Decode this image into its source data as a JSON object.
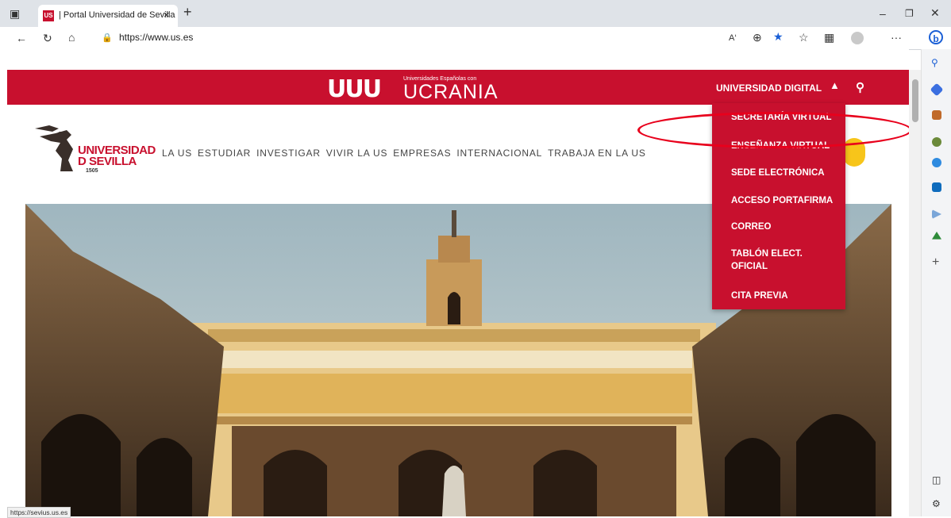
{
  "browser": {
    "tab_title": "| Portal Universidad de Sevilla",
    "tab_favicon_text": "US",
    "tab_close": "×",
    "new_tab": "+",
    "url": "https://www.us.es",
    "status_url": "https://sevius.us.es",
    "more": "···"
  },
  "banner": {
    "campaign_small": "Universidades Españolas con",
    "campaign_title": "UCRANIA",
    "campaign_mark": "UUU",
    "universidad_digital": "UNIVERSIDAD DIGITAL",
    "chevron": "^"
  },
  "logo": {
    "line1": "UNIVERSIDAD",
    "line2": "D SEVILLA",
    "year": "1505"
  },
  "nav": {
    "items": [
      "LA US",
      "ESTUDIAR",
      "INVESTIGAR",
      "VIVIR LA US",
      "EMPRESAS",
      "INTERNACIONAL",
      "TRABAJA EN LA US"
    ]
  },
  "dropdown": {
    "items": [
      "SECRETARÍA VIRTUAL",
      "ENSEÑANZA VIRTUAL",
      "SEDE ELECTRÓNICA",
      "ACCESO PORTAFIRMA",
      "CORREO",
      "TABLÓN ELECT. OFICIAL",
      "CITA PREVIA"
    ]
  },
  "colors": {
    "brand_red": "#c8102e",
    "accent_yellow": "#f7c51a",
    "highlight_ellipse": "#e8001c"
  },
  "icons": {
    "sidebar": [
      "search-icon",
      "tag-icon",
      "briefcase-icon",
      "people-icon",
      "office-icon",
      "outlook-icon",
      "send-icon",
      "tree-icon",
      "add-icon"
    ]
  }
}
